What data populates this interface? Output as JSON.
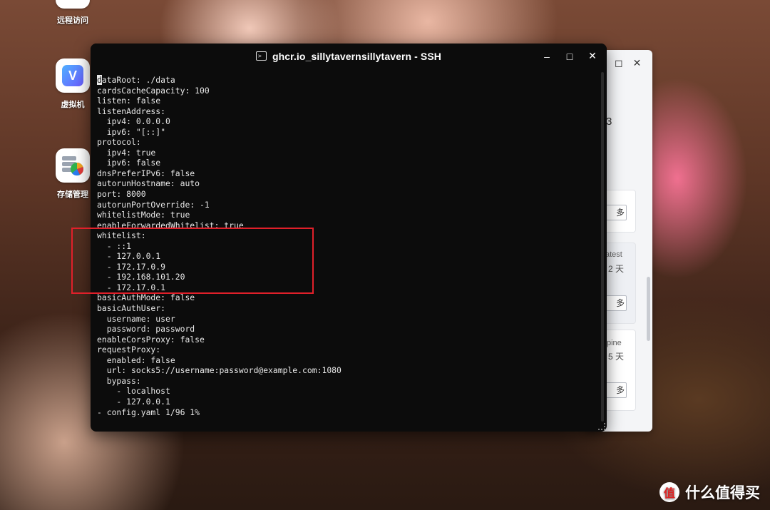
{
  "desktop": {
    "items": [
      {
        "label": "远程访问",
        "icon": "remote-access-icon"
      },
      {
        "label": "虚拟机",
        "icon": "virtual-machine-icon"
      },
      {
        "label": "存储管理",
        "icon": "storage-management-icon"
      }
    ],
    "virtual_machine_glyph": "V"
  },
  "background_window": {
    "controls": [
      "◻",
      "✕"
    ],
    "fragments": {
      "number": "3",
      "more_btn": "多",
      "tag1": "atest",
      "days1": "2 天",
      "tag2": "pine",
      "days2": "5 天"
    }
  },
  "terminal": {
    "title": "ghcr.io_sillytavernsillytavern - SSH",
    "title_icon": "terminal-icon",
    "controls": {
      "minimize": "–",
      "maximize": "□",
      "close": "✕"
    },
    "cursor_char": "d",
    "lines": [
      "ataRoot: ./data",
      "cardsCacheCapacity: 100",
      "listen: false",
      "listenAddress:",
      "  ipv4: 0.0.0.0",
      "  ipv6: \"[::]\"",
      "protocol:",
      "  ipv4: true",
      "  ipv6: false",
      "dnsPreferIPv6: false",
      "autorunHostname: auto",
      "port: 8000",
      "autorunPortOverride: -1",
      "whitelistMode: true",
      "enableForwardedWhitelist: true",
      "whitelist:",
      "  - ::1",
      "  - 127.0.0.1",
      "  - 172.17.0.9",
      "  - 192.168.101.20",
      "  - 172.17.0.1",
      "basicAuthMode: false",
      "basicAuthUser:",
      "  username: user",
      "  password: password",
      "enableCorsProxy: false",
      "requestProxy:",
      "  enabled: false",
      "  url: socks5://username:password@example.com:1080",
      "  bypass:",
      "    - localhost",
      "    - 127.0.0.1",
      "- config.yaml 1/96 1%"
    ]
  },
  "watermark": {
    "logo": "值",
    "text": "什么值得买"
  },
  "colors": {
    "terminal_bg": "#0c0c0c",
    "highlight": "#e0202a",
    "terminal_text": "#e8e8e8"
  }
}
